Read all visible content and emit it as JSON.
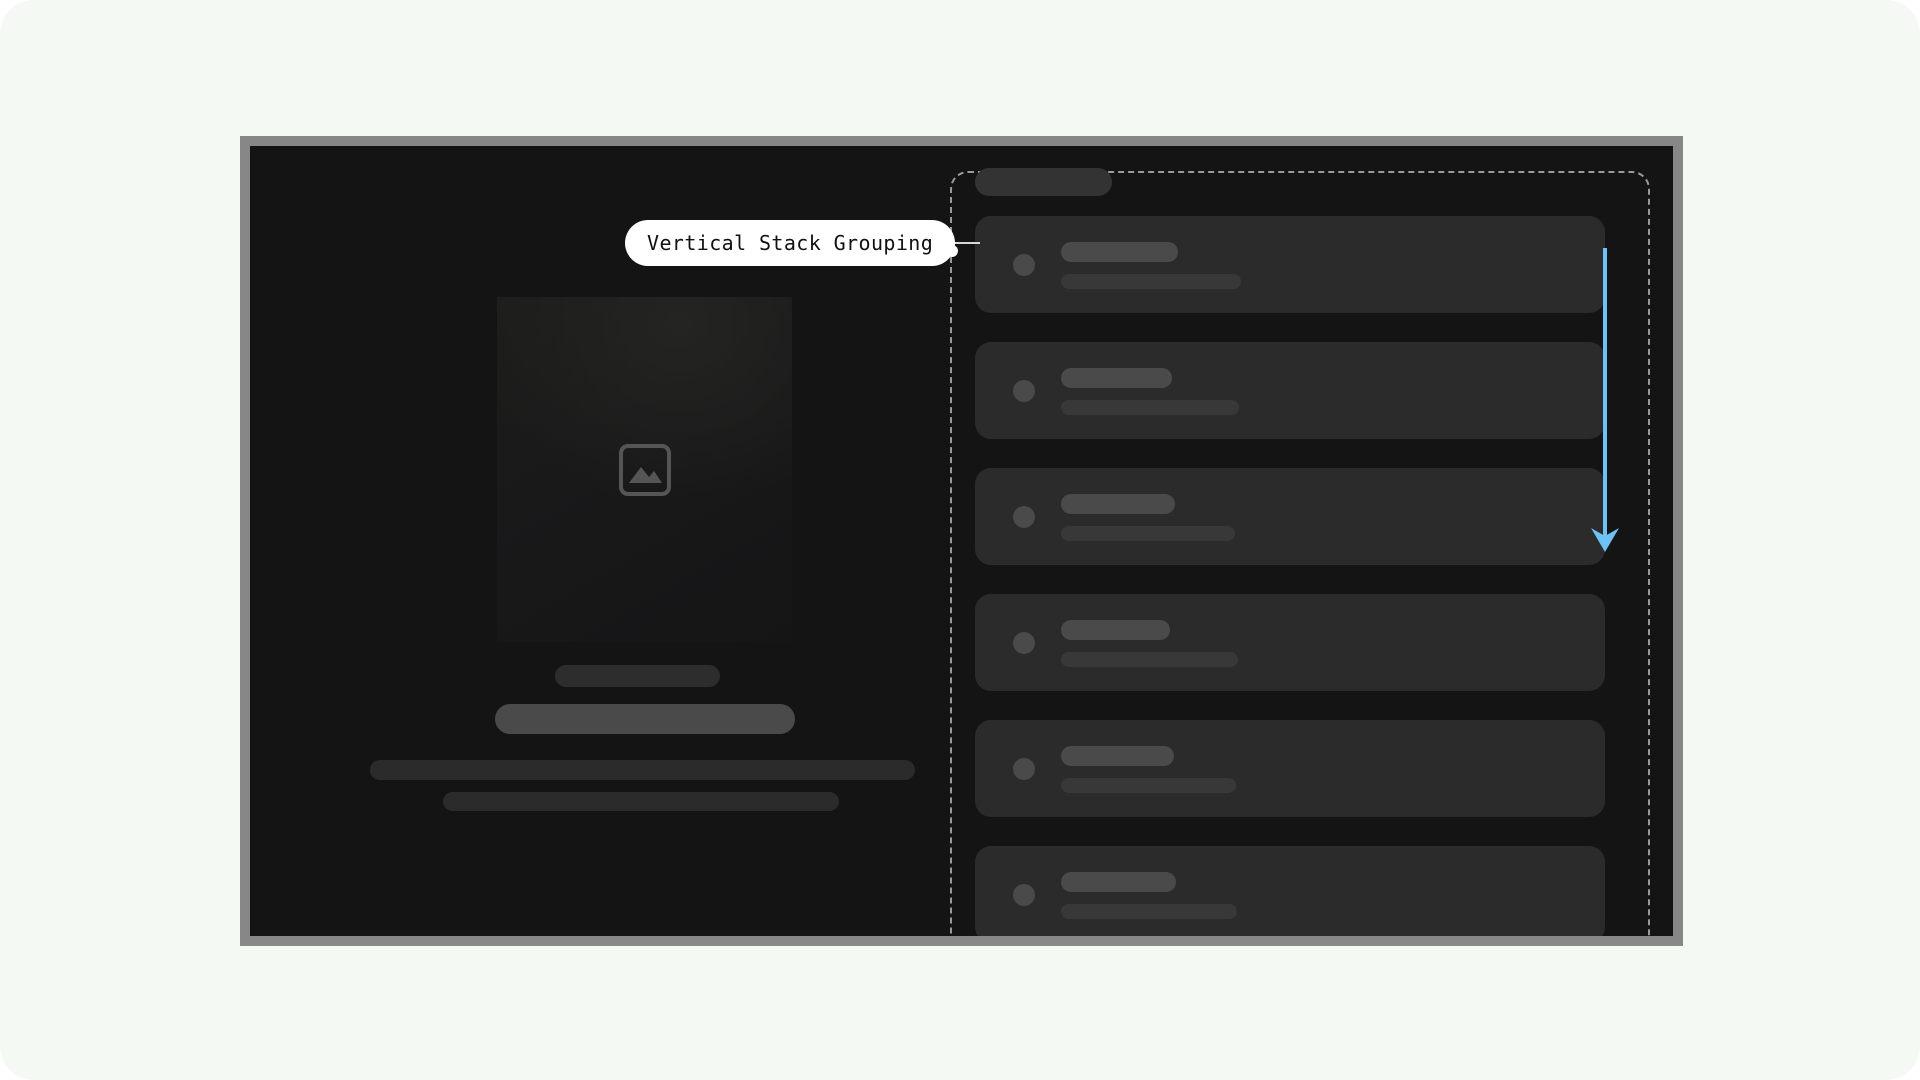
{
  "page": {
    "background_color": "#f4f9f4",
    "corner_radius_px": 34
  },
  "device_frame": {
    "name": "device-frame",
    "bezel_color": "#878787",
    "screen_color": "#141414"
  },
  "callout": {
    "label": "Vertical Stack Grouping",
    "pill_background": "#ffffff",
    "pill_text_color": "#111111",
    "connector_color": "#d8d8d8",
    "anchor_dot_color": "#ffffff"
  },
  "group_region": {
    "name": "vertical-stack-grouping-region",
    "border_style": "dashed",
    "border_color": "#9a9a9a",
    "corner_radius_px": 18
  },
  "left_pane": {
    "name": "detail-pane",
    "background_color": "#141414",
    "hero": {
      "placeholder_icon": "image-placeholder-icon",
      "icon_color": "#555555",
      "thumb_background": "#1d1d1b"
    },
    "text_placeholders": [
      {
        "name": "detail-line-1",
        "color": "#2d2d2d"
      },
      {
        "name": "detail-line-2",
        "color": "#4a4a4a"
      },
      {
        "name": "detail-line-3",
        "color": "#2b2b2b"
      },
      {
        "name": "detail-line-4",
        "color": "#2b2b2b"
      }
    ]
  },
  "right_pane": {
    "name": "list-pane",
    "header_chip": {
      "name": "list-header-placeholder",
      "color": "#333333"
    },
    "card_background": "#2b2b2b",
    "avatar_color": "#4a4a4a",
    "title_color": "#4a4a4a",
    "subtitle_color": "#383838",
    "items": [
      {
        "title_width": 117,
        "subtitle_width": 180
      },
      {
        "title_width": 111,
        "subtitle_width": 178
      },
      {
        "title_width": 114,
        "subtitle_width": 174
      },
      {
        "title_width": 109,
        "subtitle_width": 177
      },
      {
        "title_width": 113,
        "subtitle_width": 175
      },
      {
        "title_width": 115,
        "subtitle_width": 176
      }
    ]
  },
  "scroll_indicator": {
    "name": "scroll-direction-arrow",
    "direction": "down",
    "color": "#6ec1f5"
  }
}
